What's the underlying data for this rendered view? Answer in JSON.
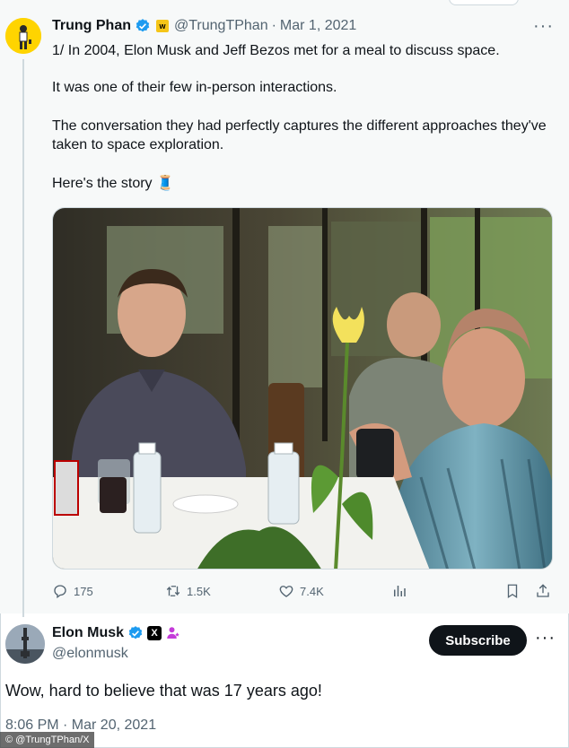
{
  "original_tweet": {
    "author_name": "Trung Phan",
    "author_handle": "@TrungTPhan",
    "date_separator": "·",
    "date": "Mar 1, 2021",
    "gold_badge_text": "w",
    "paragraphs": [
      "1/ In 2004, Elon Musk and Jeff Bezos met for a meal to discuss space.",
      "It was one of their few in-person interactions.",
      "The conversation they had perfectly captures the different approaches they've taken to space exploration.",
      "Here's the story 🧵"
    ],
    "stats": {
      "replies": "175",
      "reposts": "1.5K",
      "likes": "7.4K"
    }
  },
  "reply_tweet": {
    "author_name": "Elon Musk",
    "author_handle": "@elonmusk",
    "x_badge": "X",
    "subscribe_label": "Subscribe",
    "text": "Wow, hard to believe that was 17 years ago!",
    "timestamp": "8:06 PM · Mar 20, 2021"
  },
  "watermark": "© @TrungTPhan/X",
  "icons": [
    "verified-badge-icon",
    "gold-badge-icon",
    "more-icon",
    "reply-icon",
    "repost-icon",
    "like-icon",
    "views-icon",
    "bookmark-icon",
    "share-icon",
    "x-logo-icon",
    "affiliate-icon"
  ],
  "colors": {
    "verified_blue": "#1d9bf0",
    "secondary_text": "#536471",
    "primary_text": "#0f1419",
    "subscribe_bg": "#0f1419",
    "quoted_bg": "#f7f9f9"
  }
}
